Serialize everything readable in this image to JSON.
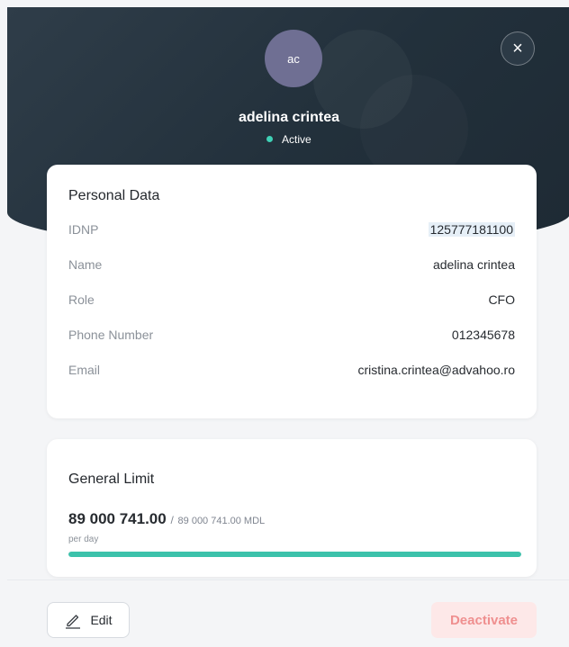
{
  "user": {
    "initials": "ac",
    "name": "adelina crintea",
    "status": "Active",
    "status_color": "#3fd1b6"
  },
  "personal_data": {
    "title": "Personal Data",
    "fields": [
      {
        "label": "IDNP",
        "value": "125777181100"
      },
      {
        "label": "Name",
        "value": "adelina crintea"
      },
      {
        "label": "Role",
        "value": "CFO"
      },
      {
        "label": "Phone Number",
        "value": "012345678"
      },
      {
        "label": "Email",
        "value": "cristina.crintea@advahoo.ro"
      }
    ]
  },
  "general_limit": {
    "title": "General Limit",
    "used": "89 000 741.00",
    "separator": "/",
    "total": "89 000 741.00 MDL",
    "period": "per day",
    "progress_fraction": 1.0,
    "progress_color": "#3cc2ab"
  },
  "actions": {
    "edit_label": "Edit",
    "deactivate_label": "Deactivate"
  },
  "icons": {
    "close": "close-icon",
    "edit": "pencil-icon"
  }
}
